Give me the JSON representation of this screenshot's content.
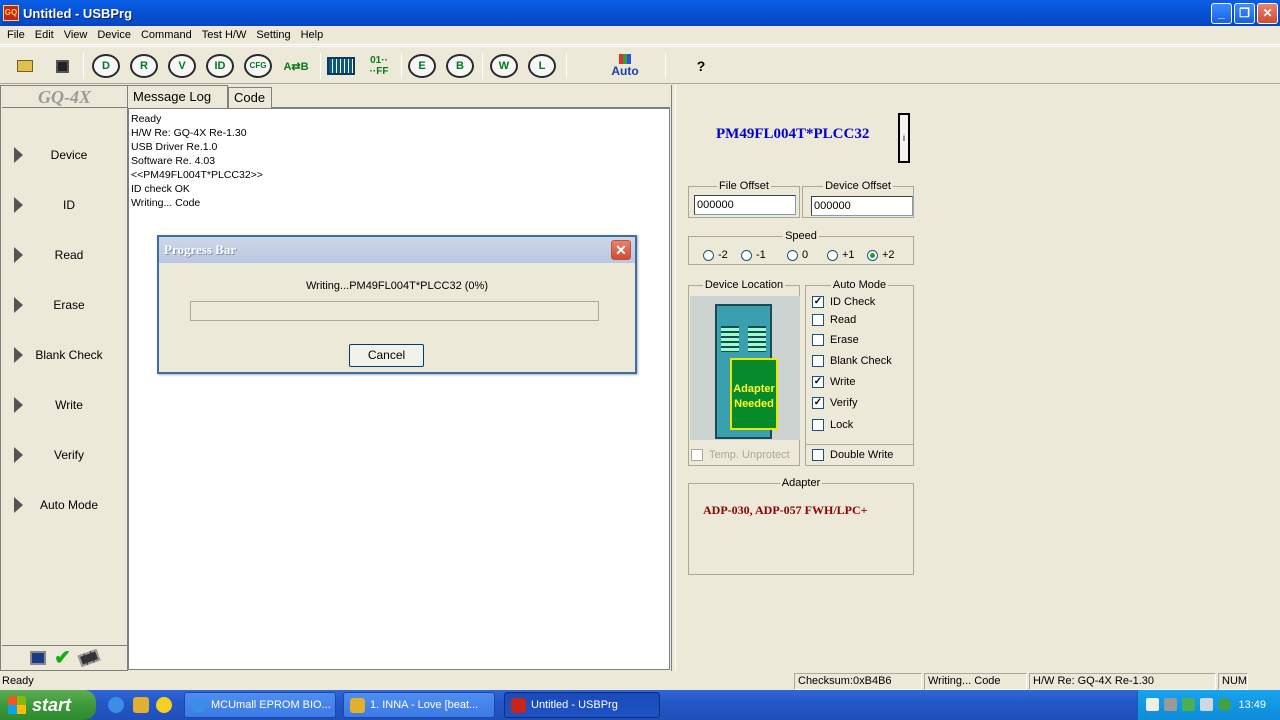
{
  "window": {
    "title": "Untitled - USBPrg",
    "app_icon_text": "GQ"
  },
  "menu": [
    "File",
    "Edit",
    "View",
    "Device",
    "Command",
    "Test H/W",
    "Setting",
    "Help"
  ],
  "toolbar": {
    "open": "open-icon",
    "save": "save-icon",
    "device": "D",
    "read": "R",
    "verify": "V",
    "id": "ID",
    "cfg": "CFG",
    "compare": "A⇄B",
    "auto_label": "Auto",
    "help": "?"
  },
  "left_panel": {
    "brand": "GQ-4X",
    "buttons": [
      "Device",
      "ID",
      "Read",
      "Erase",
      "Blank Check",
      "Write",
      "Verify",
      "Auto Mode"
    ]
  },
  "tabs": [
    "Message Log",
    "Code"
  ],
  "log": [
    "Ready",
    "H/W Re: GQ-4X Re-1.30",
    "USB Driver Re.1.0",
    "Software Re. 4.03",
    "<<PM49FL004T*PLCC32>>",
    "ID check OK",
    "Writing... Code"
  ],
  "dialog": {
    "title": "Progress Bar",
    "message": "Writing...PM49FL004T*PLCC32 (0%)",
    "progress": 0,
    "cancel": "Cancel"
  },
  "device": {
    "name": "PM49FL004T*PLCC32",
    "info_button": "i",
    "file_offset_label": "File Offset",
    "file_offset": "000000",
    "device_offset_label": "Device Offset",
    "device_offset": "000000",
    "speed_label": "Speed",
    "speeds": [
      "-2",
      "-1",
      "0",
      "+1",
      "+2"
    ],
    "speed_selected": "+2",
    "location_label": "Device Location",
    "adapter_needed": "Adapter Needed",
    "temp_unprotect": "Temp. Unprotect",
    "auto_mode_label": "Auto Mode",
    "auto_mode": [
      {
        "label": "ID Check",
        "checked": true
      },
      {
        "label": "Read",
        "checked": false
      },
      {
        "label": "Erase",
        "checked": false
      },
      {
        "label": "Blank Check",
        "checked": false
      },
      {
        "label": "Write",
        "checked": true
      },
      {
        "label": "Verify",
        "checked": true
      },
      {
        "label": "Lock",
        "checked": false
      }
    ],
    "double_write": "Double Write",
    "adapter_label": "Adapter",
    "adapter": "ADP-030, ADP-057 FWH/LPC+"
  },
  "statusbar": {
    "left": "Ready",
    "checksum": "Checksum:0xB4B6",
    "activity": "Writing... Code",
    "hw": "H/W Re: GQ-4X Re-1.30",
    "num": "NUM"
  },
  "taskbar": {
    "start": "start",
    "tasks": [
      "MCUmall EPROM BIO...",
      "1. INNA - Love [beat...",
      "Untitled - USBPrg"
    ],
    "time": "13:49"
  }
}
